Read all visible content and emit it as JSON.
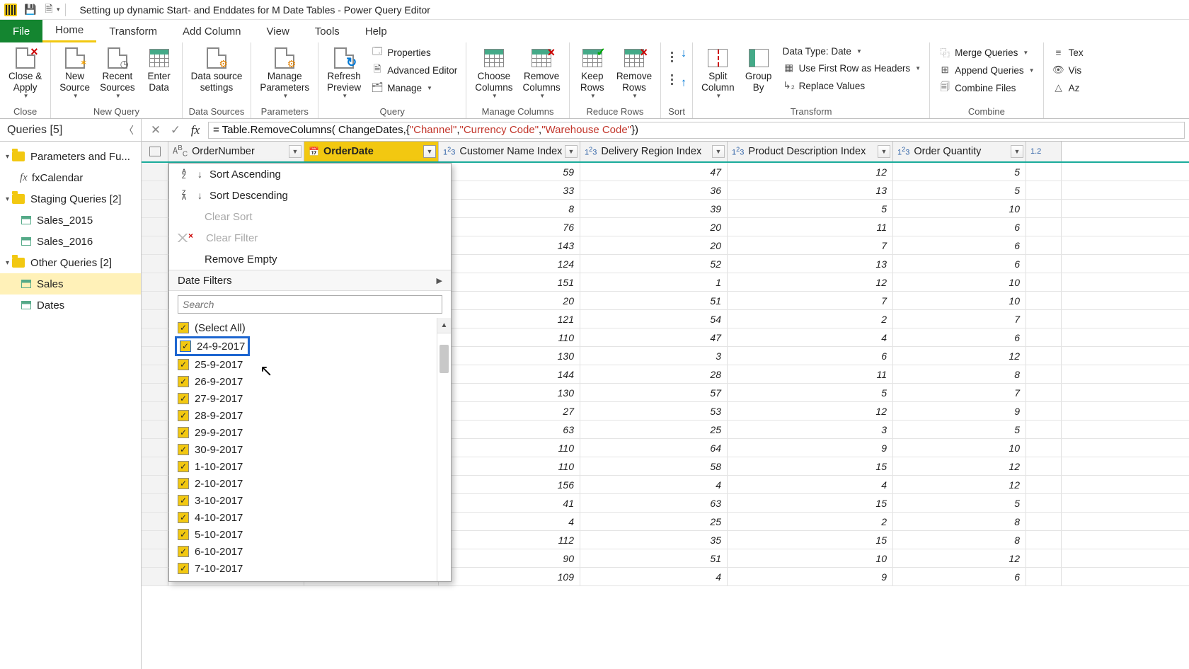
{
  "title": "Setting up dynamic Start- and Enddates for M Date Tables - Power Query Editor",
  "menu": {
    "file": "File",
    "home": "Home",
    "transform": "Transform",
    "addcolumn": "Add Column",
    "view": "View",
    "tools": "Tools",
    "help": "Help"
  },
  "ribbon": {
    "close_apply": "Close &\nApply",
    "close_group": "Close",
    "new_source": "New\nSource",
    "recent_sources": "Recent\nSources",
    "enter_data": "Enter\nData",
    "new_query_group": "New Query",
    "data_source_settings": "Data source\nsettings",
    "data_sources_group": "Data Sources",
    "manage_parameters": "Manage\nParameters",
    "parameters_group": "Parameters",
    "refresh_preview": "Refresh\nPreview",
    "properties": "Properties",
    "advanced_editor": "Advanced Editor",
    "manage": "Manage",
    "query_group": "Query",
    "choose_columns": "Choose\nColumns",
    "remove_columns": "Remove\nColumns",
    "manage_columns_group": "Manage Columns",
    "keep_rows": "Keep\nRows",
    "remove_rows": "Remove\nRows",
    "reduce_rows_group": "Reduce Rows",
    "sort_group": "Sort",
    "split_column": "Split\nColumn",
    "group_by": "Group\nBy",
    "data_type": "Data Type: Date",
    "first_row_headers": "Use First Row as Headers",
    "replace_values": "Replace Values",
    "transform_group": "Transform",
    "merge_queries": "Merge Queries",
    "append_queries": "Append Queries",
    "combine_files": "Combine Files",
    "combine_group": "Combine",
    "tex": "Tex",
    "vis": "Vis",
    "az": "Az"
  },
  "formula": {
    "p1": "= Table.RemoveColumns( ChangeDates,{",
    "p2": "\"Channel\"",
    "p3": ", ",
    "p4": "\"Currency Code\"",
    "p5": ", ",
    "p6": "\"Warehouse Code\"",
    "p7": "})"
  },
  "queries": {
    "header": "Queries [5]",
    "group1": "Parameters and Fu...",
    "fxcal": "fxCalendar",
    "group2": "Staging Queries [2]",
    "s2015": "Sales_2015",
    "s2016": "Sales_2016",
    "group3": "Other Queries [2]",
    "sales": "Sales",
    "dates": "Dates"
  },
  "columns": {
    "c0": "OrderNumber",
    "c1": "OrderDate",
    "c2": "Customer Name Index",
    "c3": "Delivery Region Index",
    "c4": "Product Description Index",
    "c5": "Order Quantity",
    "c6": "1.2"
  },
  "filter": {
    "sort_asc": "Sort Ascending",
    "sort_desc": "Sort Descending",
    "clear_sort": "Clear Sort",
    "clear_filter": "Clear Filter",
    "remove_empty": "Remove Empty",
    "date_filters": "Date Filters",
    "search": "Search",
    "select_all": "(Select All)",
    "items": [
      "24-9-2017",
      "25-9-2017",
      "26-9-2017",
      "27-9-2017",
      "28-9-2017",
      "29-9-2017",
      "30-9-2017",
      "1-10-2017",
      "2-10-2017",
      "3-10-2017",
      "4-10-2017",
      "5-10-2017",
      "6-10-2017",
      "7-10-2017"
    ]
  },
  "table_data": [
    {
      "c2": "59",
      "c3": "47",
      "c4": "12",
      "c5": "5"
    },
    {
      "c2": "33",
      "c3": "36",
      "c4": "13",
      "c5": "5"
    },
    {
      "c2": "8",
      "c3": "39",
      "c4": "5",
      "c5": "10"
    },
    {
      "c2": "76",
      "c3": "20",
      "c4": "11",
      "c5": "6"
    },
    {
      "c2": "143",
      "c3": "20",
      "c4": "7",
      "c5": "6"
    },
    {
      "c2": "124",
      "c3": "52",
      "c4": "13",
      "c5": "6"
    },
    {
      "c2": "151",
      "c3": "1",
      "c4": "12",
      "c5": "10"
    },
    {
      "c2": "20",
      "c3": "51",
      "c4": "7",
      "c5": "10"
    },
    {
      "c2": "121",
      "c3": "54",
      "c4": "2",
      "c5": "7"
    },
    {
      "c2": "110",
      "c3": "47",
      "c4": "4",
      "c5": "6"
    },
    {
      "c2": "130",
      "c3": "3",
      "c4": "6",
      "c5": "12"
    },
    {
      "c2": "144",
      "c3": "28",
      "c4": "11",
      "c5": "8"
    },
    {
      "c2": "130",
      "c3": "57",
      "c4": "5",
      "c5": "7"
    },
    {
      "c2": "27",
      "c3": "53",
      "c4": "12",
      "c5": "9"
    },
    {
      "c2": "63",
      "c3": "25",
      "c4": "3",
      "c5": "5"
    },
    {
      "c2": "110",
      "c3": "64",
      "c4": "9",
      "c5": "10"
    },
    {
      "c2": "110",
      "c3": "58",
      "c4": "15",
      "c5": "12"
    },
    {
      "c2": "156",
      "c3": "4",
      "c4": "4",
      "c5": "12"
    },
    {
      "c2": "41",
      "c3": "63",
      "c4": "15",
      "c5": "5"
    },
    {
      "c2": "4",
      "c3": "25",
      "c4": "2",
      "c5": "8"
    },
    {
      "c2": "112",
      "c3": "35",
      "c4": "15",
      "c5": "8"
    },
    {
      "c2": "90",
      "c3": "51",
      "c4": "10",
      "c5": "12"
    },
    {
      "c2": "109",
      "c3": "4",
      "c4": "9",
      "c5": "6"
    }
  ]
}
